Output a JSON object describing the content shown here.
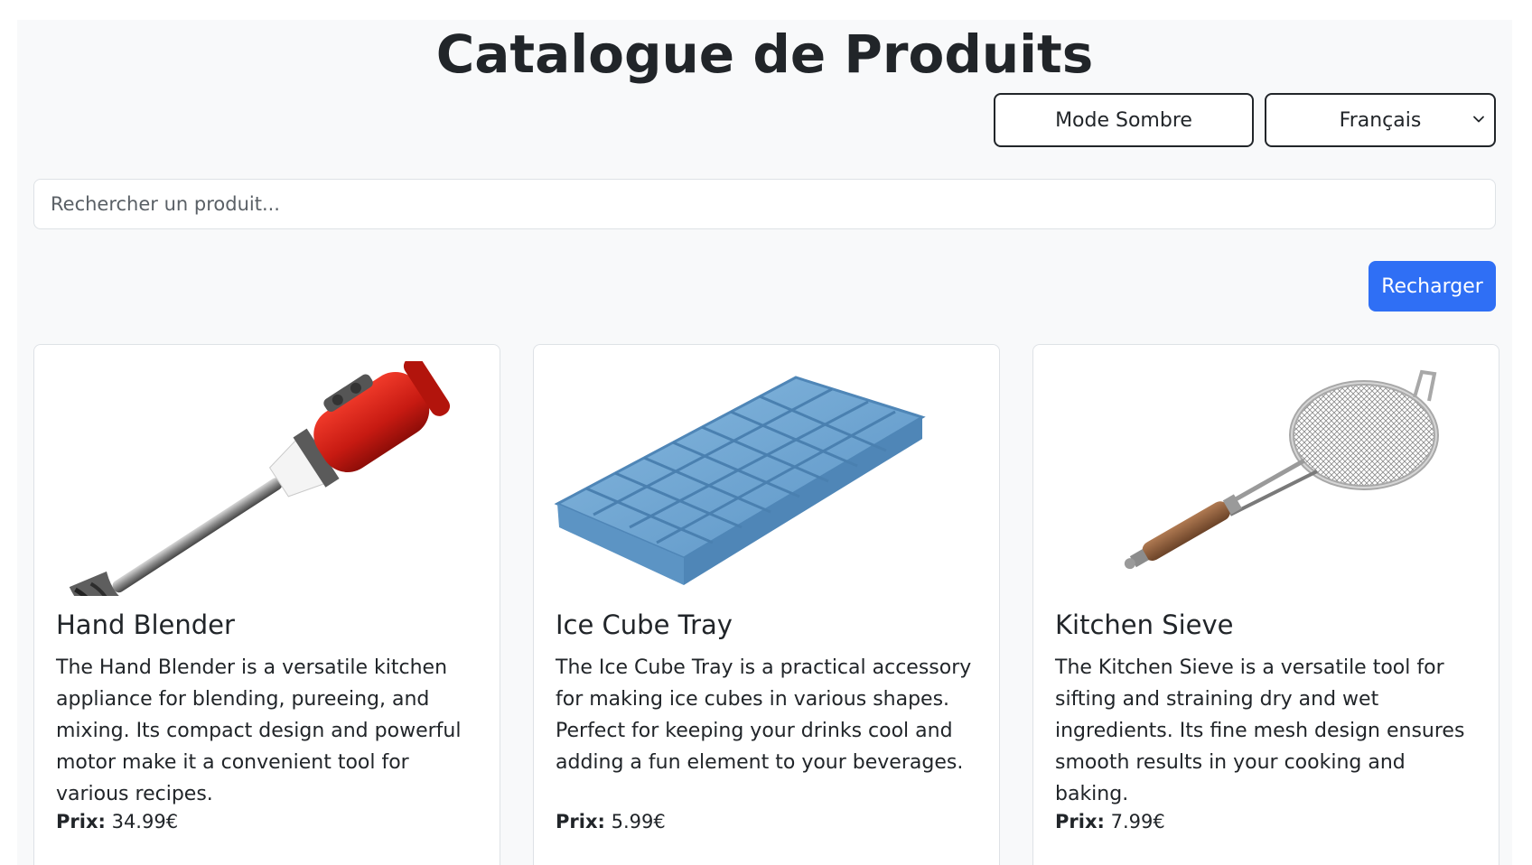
{
  "header": {
    "title": "Catalogue de Produits",
    "dark_mode_label": "Mode Sombre",
    "language_selected": "Français"
  },
  "search": {
    "placeholder": "Rechercher un produit..."
  },
  "reload_label": "Recharger",
  "price_label": "Prix:",
  "products": [
    {
      "name": "Hand Blender",
      "description": "The Hand Blender is a versatile kitchen appliance for blending, pureeing, and mixing. Its compact design and powerful motor make it a convenient tool for various recipes.",
      "price": "34.99€",
      "image_icon": "hand-blender-icon"
    },
    {
      "name": "Ice Cube Tray",
      "description": "The Ice Cube Tray is a practical accessory for making ice cubes in various shapes. Perfect for keeping your drinks cool and adding a fun element to your beverages.",
      "price": "5.99€",
      "image_icon": "ice-cube-tray-icon"
    },
    {
      "name": "Kitchen Sieve",
      "description": "The Kitchen Sieve is a versatile tool for sifting and straining dry and wet ingredients. Its fine mesh design ensures smooth results in your cooking and baking.",
      "price": "7.99€",
      "image_icon": "kitchen-sieve-icon"
    }
  ],
  "colors": {
    "primary": "#2f6ff5",
    "background": "#f8f9fa",
    "text": "#212529"
  }
}
